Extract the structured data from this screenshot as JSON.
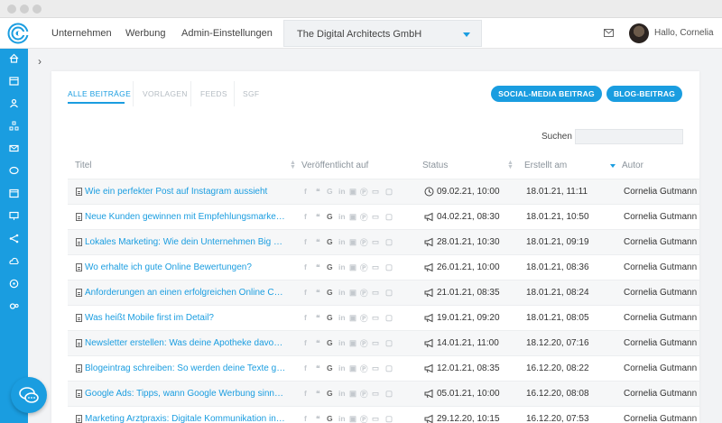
{
  "header": {
    "nav": [
      "Unternehmen",
      "Werbung",
      "Admin-Einstellungen"
    ],
    "company": "The Digital Architects GmbH",
    "greeting": "Hallo, Cornelia"
  },
  "sidebar": {
    "icons": [
      "home-icon",
      "calendar-icon",
      "users-icon",
      "sitemap-icon",
      "mail-icon",
      "chat-icon",
      "browser-icon",
      "monitor-icon",
      "share-icon",
      "cloud-icon",
      "messages-icon",
      "settings-icon"
    ]
  },
  "tabs": [
    "ALLE BEITRÄGE",
    "VORLAGEN",
    "FEEDS",
    "SGF"
  ],
  "buttons": {
    "social": "SOCIAL-MEDIA BEITRAG",
    "blog": "BLOG-BEITRAG"
  },
  "search": {
    "label": "Suchen",
    "value": ""
  },
  "columns": {
    "title": "Titel",
    "published": "Veröffentlicht auf",
    "status": "Status",
    "created": "Erstellt am",
    "author": "Autor"
  },
  "accent": "#1a9de0",
  "rows": [
    {
      "title": "Wie ein perfekter Post auf Instagram aussieht",
      "status_icon": "clock-icon",
      "status": "09.02.21, 10:00",
      "created": "18.01.21, 11:11",
      "author": "Cornelia Gutmann"
    },
    {
      "title": "Neue Kunden gewinnen mit Empfehlungsmarketing",
      "status_icon": "megaphone-icon",
      "status": "04.02.21, 08:30",
      "created": "18.01.21, 10:50",
      "author": "Cornelia Gutmann"
    },
    {
      "title": "Lokales Marketing: Wie dein Unternehmen Big Player schlägt",
      "status_icon": "megaphone-icon",
      "status": "28.01.21, 10:30",
      "created": "18.01.21, 09:19",
      "author": "Cornelia Gutmann"
    },
    {
      "title": "Wo erhalte ich gute Online Bewertungen?",
      "status_icon": "megaphone-icon",
      "status": "26.01.21, 10:00",
      "created": "18.01.21, 08:36",
      "author": "Cornelia Gutmann"
    },
    {
      "title": "Anforderungen an einen erfolgreichen Online Content",
      "status_icon": "megaphone-icon",
      "status": "21.01.21, 08:35",
      "created": "18.01.21, 08:24",
      "author": "Cornelia Gutmann"
    },
    {
      "title": "Was heißt Mobile first im Detail?",
      "status_icon": "megaphone-icon",
      "status": "19.01.21, 09:20",
      "created": "18.01.21, 08:05",
      "author": "Cornelia Gutmann"
    },
    {
      "title": "Newsletter erstellen: Was deine Apotheke davon hat",
      "status_icon": "megaphone-icon",
      "status": "14.01.21, 11:00",
      "created": "18.12.20, 07:16",
      "author": "Cornelia Gutmann"
    },
    {
      "title": "Blogeintrag schreiben: So werden deine Texte gelesen",
      "status_icon": "megaphone-icon",
      "status": "12.01.21, 08:35",
      "created": "16.12.20, 08:22",
      "author": "Cornelia Gutmann"
    },
    {
      "title": "Google Ads: Tipps, wann Google Werbung sinnvoll ist",
      "status_icon": "megaphone-icon",
      "status": "05.01.21, 10:00",
      "created": "16.12.20, 08:08",
      "author": "Cornelia Gutmann"
    },
    {
      "title": "Marketing Arztpraxis: Digitale Kommunikation in der Praxis",
      "status_icon": "megaphone-icon",
      "status": "29.12.20, 10:15",
      "created": "16.12.20, 07:53",
      "author": "Cornelia Gutmann"
    }
  ]
}
